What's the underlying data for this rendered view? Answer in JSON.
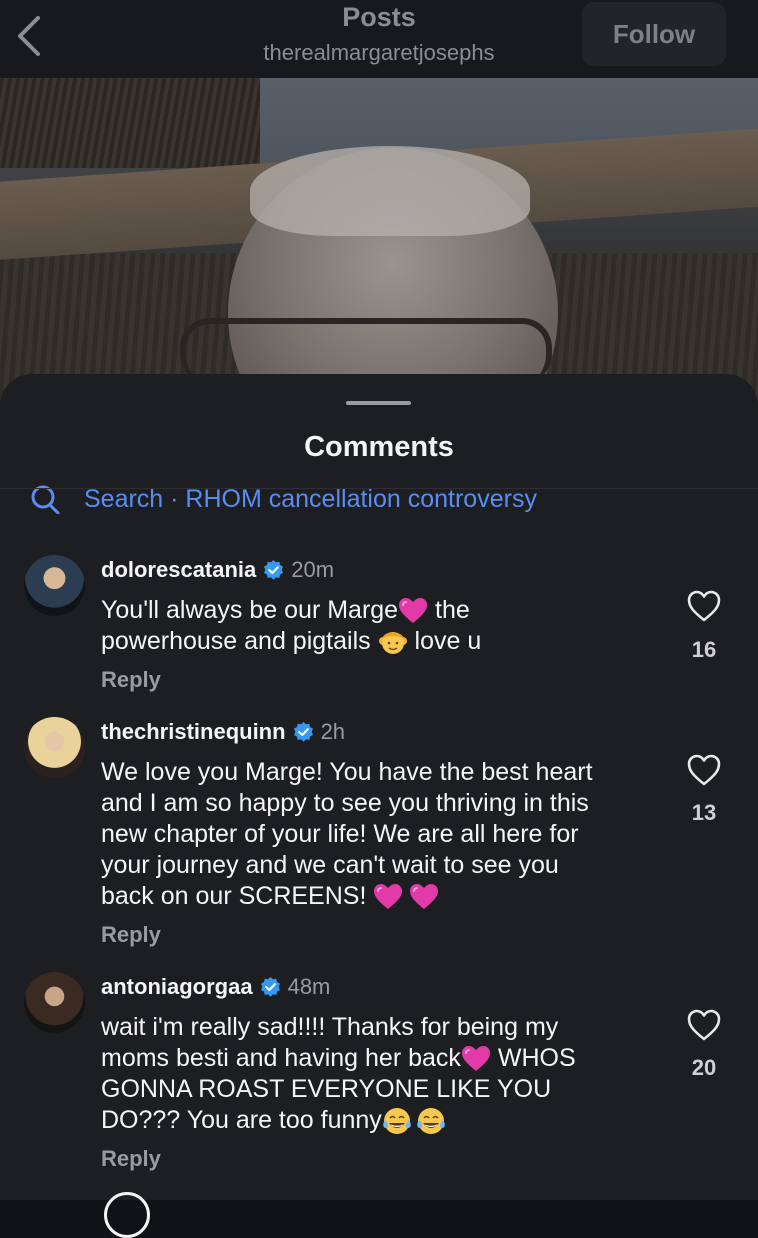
{
  "header": {
    "title": "Posts",
    "username": "therealmargaretjosephs",
    "follow_label": "Follow"
  },
  "sheet": {
    "title": "Comments",
    "search_text": "Search · RHOM cancellation controversy"
  },
  "comments": [
    {
      "username": "dolorescatania",
      "time": "20m",
      "lines": [
        "You'll always be our Marge",
        " the",
        "powerhouse and pigtails ",
        " love u"
      ],
      "reply": "Reply",
      "likes": "16"
    },
    {
      "username": "thechristinequinn",
      "time": "2h",
      "lines": [
        "We love you Marge! You have the best heart",
        "and I am so happy to see you thriving in this",
        "new chapter of your life! We are all here for",
        "your journey and we can't wait to see you",
        "back on our SCREENS! "
      ],
      "reply": "Reply",
      "likes": "13"
    },
    {
      "username": "antoniagorgaa",
      "time": "48m",
      "lines": [
        "wait i'm really sad!!!! Thanks for being my",
        "moms besti and having her back",
        " WHOS",
        "GONNA ROAST EVERYONE LIKE YOU",
        "DO??? You are too funny"
      ],
      "reply": "Reply",
      "likes": "20"
    }
  ],
  "icons": {
    "back": "chevron-left-icon",
    "search": "search-icon",
    "verified": "verified-badge-icon",
    "like": "heart-outline-icon",
    "pink_heart": "pink-heart-emoji",
    "girl": "girl-with-pigtails-emoji",
    "laughing": "tears-of-joy-emoji"
  },
  "colors": {
    "link_blue": "#5b8cf2",
    "verified_blue": "#3897f0",
    "emoji_pink": "#e23aa8",
    "sheet_bg": "#1d1e22"
  }
}
